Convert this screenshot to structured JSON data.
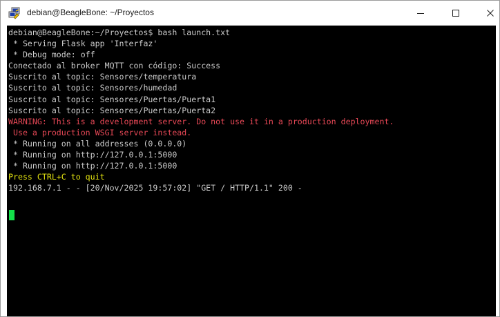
{
  "window": {
    "title": "debian@BeagleBone: ~/Proyectos",
    "icon": "putty-icon",
    "controls": {
      "minimize_icon": "minimize-icon",
      "maximize_icon": "maximize-icon",
      "close_icon": "close-icon"
    }
  },
  "colors": {
    "terminal_bg": "#000000",
    "default_text": "#cccccc",
    "warning_text": "#e74856",
    "notice_text": "#e5e510",
    "cursor": "#13e04a"
  },
  "terminal": {
    "lines": [
      {
        "text": "debian@BeagleBone:~/Proyectos$ bash launch.txt",
        "color": "gray"
      },
      {
        "text": " * Serving Flask app 'Interfaz'",
        "color": "gray"
      },
      {
        "text": " * Debug mode: off",
        "color": "gray"
      },
      {
        "text": "Conectado al broker MQTT con código: Success",
        "color": "gray"
      },
      {
        "text": "Suscrito al topic: Sensores/temperatura",
        "color": "gray"
      },
      {
        "text": "Suscrito al topic: Sensores/humedad",
        "color": "gray"
      },
      {
        "text": "Suscrito al topic: Sensores/Puertas/Puerta1",
        "color": "gray"
      },
      {
        "text": "Suscrito al topic: Sensores/Puertas/Puerta2",
        "color": "gray"
      },
      {
        "text": "WARNING: This is a development server. Do not use it in a production deployment.",
        "color": "red"
      },
      {
        "text": " Use a production WSGI server instead.",
        "color": "red"
      },
      {
        "text": " * Running on all addresses (0.0.0.0)",
        "color": "gray"
      },
      {
        "text": " * Running on http://127.0.0.1:5000",
        "color": "gray"
      },
      {
        "text": " * Running on http://127.0.0.1:5000",
        "color": "gray"
      },
      {
        "text": "Press CTRL+C to quit",
        "color": "yellow"
      },
      {
        "text": "192.168.7.1 - - [20/Nov/2025 19:57:02] \"GET / HTTP/1.1\" 200 -",
        "color": "gray"
      }
    ]
  }
}
